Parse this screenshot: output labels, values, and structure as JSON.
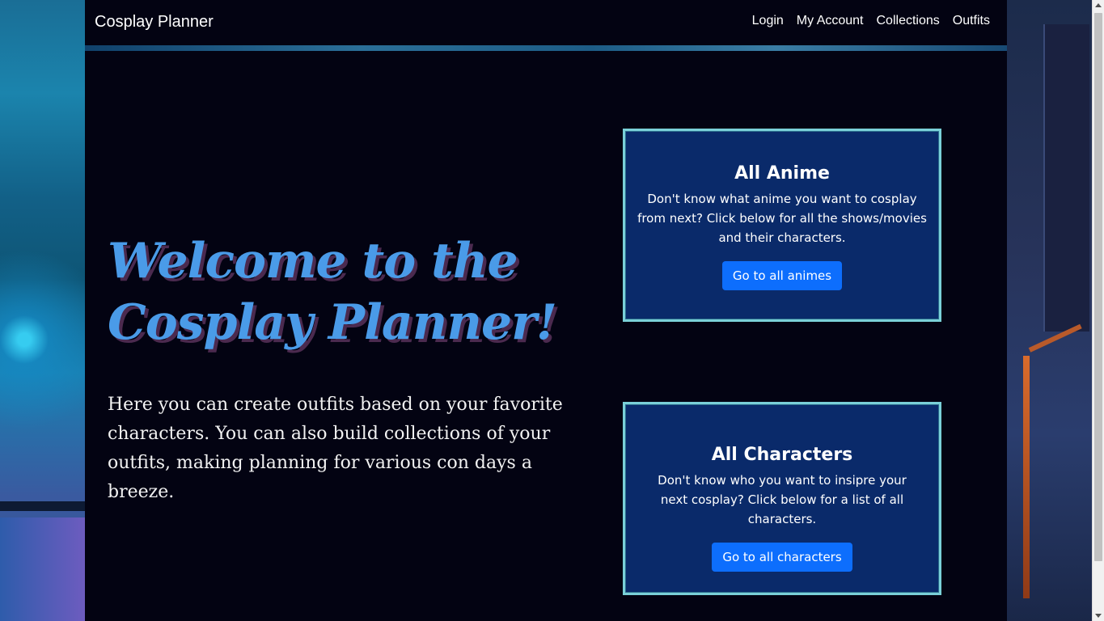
{
  "navbar": {
    "brand": "Cosplay Planner",
    "links": [
      "Login",
      "My Account",
      "Collections",
      "Outfits"
    ]
  },
  "hero": {
    "title": "Welcome to the Cosplay Planner!",
    "text": "Here you can create outfits based on your favorite characters. You can also build collections of your outfits, making planning for various con days a breeze."
  },
  "cards": [
    {
      "title": "All Anime",
      "text": "Don't know what anime you want to cosplay from next? Click below for all the shows/movies and their characters.",
      "button": "Go to all animes"
    },
    {
      "title": "All Characters",
      "text": "Don't know who you want to insipre your next cosplay? Click below for a list of all characters.",
      "button": "Go to all characters"
    }
  ],
  "colors": {
    "accent": "#0d6efd",
    "card_bg": "#0a2a6a",
    "card_border": "#7ad0d8",
    "title_text": "#4a9be8",
    "page_bg": "#030312"
  }
}
